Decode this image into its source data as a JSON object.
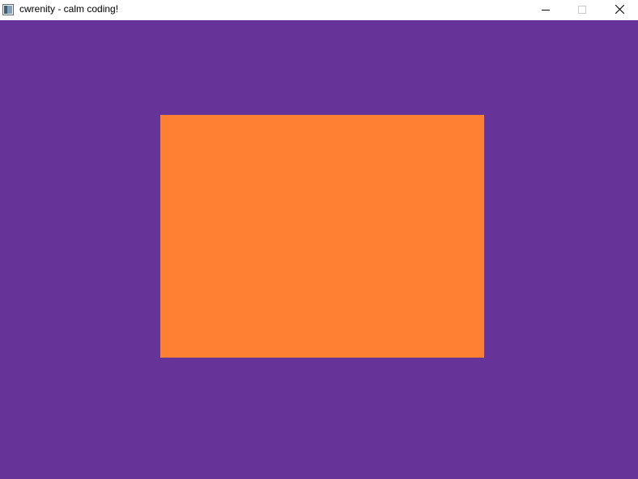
{
  "window": {
    "title": "cwrenity - calm coding!",
    "icon": "app-window-icon",
    "controls": {
      "minimize_icon": "minimize-icon",
      "maximize_icon": "maximize-icon",
      "close_icon": "close-icon"
    }
  },
  "canvas": {
    "background_color": "#663399",
    "rectangle_color": "#ff7f33"
  }
}
